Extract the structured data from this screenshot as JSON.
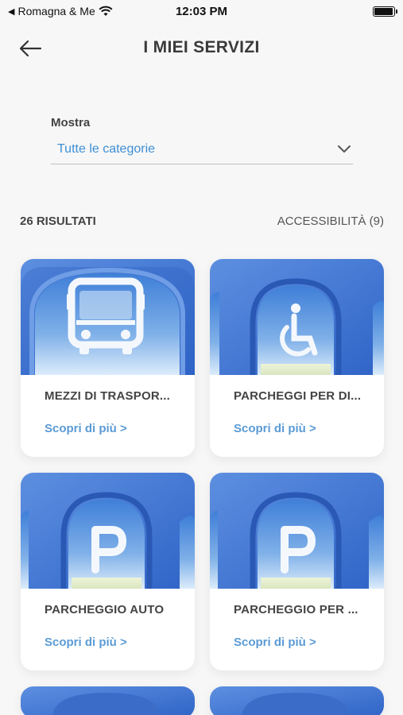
{
  "status_bar": {
    "carrier": "Romagna & Me",
    "time": "12:03 PM"
  },
  "header": {
    "title": "I MIEI SERVIZI"
  },
  "filter": {
    "label": "Mostra",
    "value": "Tutte le categorie"
  },
  "results": {
    "count_label": "26 RISULTATI",
    "filter_chip": "ACCESSIBILITÀ (9)"
  },
  "colors": {
    "accent": "#3d8fd6",
    "link": "#5b9bd5",
    "sky": "#5a8fd9"
  },
  "cards": [
    {
      "title": "MEZZI DI TRASPOR...",
      "link": "Scopri di più >",
      "icon": "bus-icon"
    },
    {
      "title": "PARCHEGGI PER DI...",
      "link": "Scopri di più >",
      "icon": "wheelchair-icon"
    },
    {
      "title": "PARCHEGGIO AUTO",
      "link": "Scopri di più >",
      "icon": "parking-icon"
    },
    {
      "title": "PARCHEGGIO PER ...",
      "link": "Scopri di più >",
      "icon": "parking-icon"
    }
  ]
}
